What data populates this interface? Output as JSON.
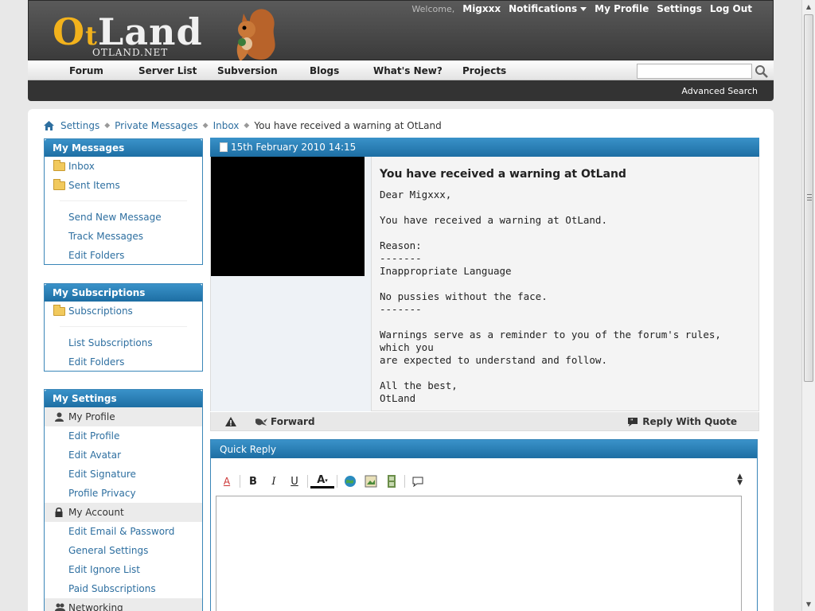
{
  "header": {
    "logo_text": "OtLand",
    "logo_sub": "OTLAND.NET",
    "welcome": "Welcome,",
    "username": "Migxxx",
    "notifications": "Notifications",
    "my_profile": "My Profile",
    "settings": "Settings",
    "logout": "Log Out"
  },
  "nav": {
    "items": [
      "Forum",
      "Server List",
      "Subversion",
      "Blogs",
      "What's New?",
      "Projects"
    ],
    "search_placeholder": "",
    "advanced_search": "Advanced Search"
  },
  "breadcrumb": {
    "items": [
      "Settings",
      "Private Messages",
      "Inbox"
    ],
    "current": "You have received a warning at OtLand"
  },
  "sidebar": {
    "my_messages": {
      "title": "My Messages",
      "folders": [
        "Inbox",
        "Sent Items"
      ],
      "links": [
        "Send New Message",
        "Track Messages",
        "Edit Folders"
      ]
    },
    "my_subscriptions": {
      "title": "My Subscriptions",
      "folders": [
        "Subscriptions"
      ],
      "links": [
        "List Subscriptions",
        "Edit Folders"
      ]
    },
    "my_settings": {
      "title": "My Settings",
      "profile_group": "My Profile",
      "profile_links": [
        "Edit Profile",
        "Edit Avatar",
        "Edit Signature",
        "Profile Privacy"
      ],
      "account_group": "My Account",
      "account_links": [
        "Edit Email & Password",
        "General Settings",
        "Edit Ignore List",
        "Paid Subscriptions"
      ],
      "networking_group": "Networking"
    }
  },
  "message": {
    "date": "15th February 2010 14:15",
    "title": "You have received a warning at OtLand",
    "body": "Dear Migxxx,\n\nYou have received a warning at OtLand.\n\nReason:\n-------\nInappropriate Language\n\nNo pussies without the face.\n-------\n\nWarnings serve as a reminder to you of the forum's rules, which you\nare expected to understand and follow.\n\nAll the best,\nOtLand",
    "forward": "Forward",
    "reply_with_quote": "Reply With Quote"
  },
  "quick_reply": {
    "title": "Quick Reply",
    "text": ""
  },
  "colors": {
    "accent": "#1d6ea3",
    "link": "#2e6fa0",
    "header_bg": "#3b3b3b"
  }
}
